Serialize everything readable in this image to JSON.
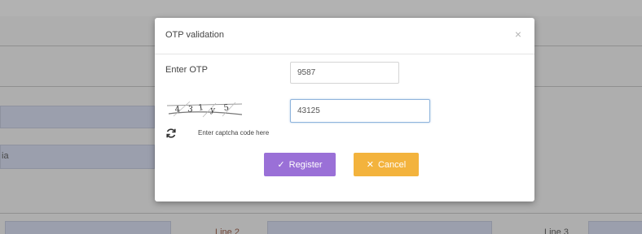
{
  "background": {
    "label_left": "ia",
    "label_mid": "Line 2",
    "label_right": "Line 3"
  },
  "modal": {
    "title": "OTP validation",
    "close_icon": "close-icon",
    "otp_label": "Enter OTP",
    "otp_value": "9587",
    "captcha_image_text": "4 3 1 y 5",
    "captcha_value": "43125",
    "captcha_hint": "Enter captcha code here",
    "refresh_icon": "refresh-icon",
    "register_label": "Register",
    "register_icon": "check-icon",
    "cancel_label": "Cancel",
    "cancel_icon": "close-icon"
  },
  "colors": {
    "register": "#9a70d7",
    "cancel": "#f3b33d",
    "backdrop": "#bfbfbf"
  }
}
